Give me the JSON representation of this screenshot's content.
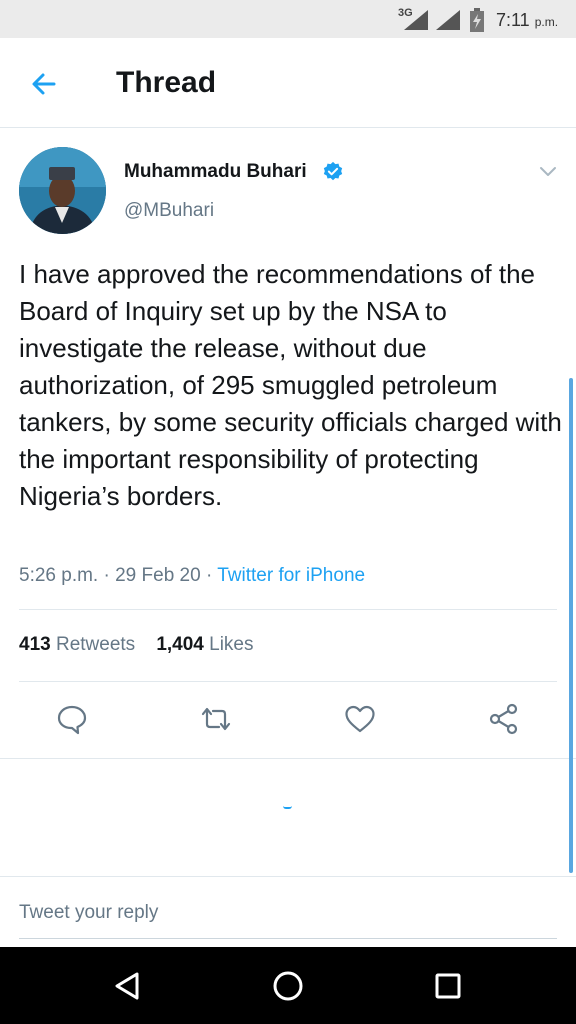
{
  "status_bar": {
    "network": "3G",
    "time": "7:11",
    "time_suffix": "p.m.",
    "icons": [
      "signal-icon",
      "signal-icon",
      "battery-icon"
    ]
  },
  "header": {
    "title": "Thread",
    "back_icon": "arrow-left-icon"
  },
  "tweet": {
    "author_name": "Muhammadu Buhari",
    "handle": "@MBuhari",
    "verified_icon": "verified-badge-icon",
    "text": "I have approved the recommendations of the Board of Inquiry set up by the NSA to investigate the release, without due authorization, of 295 smuggled petroleum tankers, by some security officials charged with the important responsibility of protecting Nigeria’s borders.",
    "time": "5:26 p.m.",
    "separator": "·",
    "date": "29 Feb 20",
    "source": "Twitter for iPhone",
    "retweets_count": "413",
    "retweets_label": "Retweets",
    "likes_count": "1,404",
    "likes_label": "Likes"
  },
  "actions": [
    "reply-icon",
    "retweet-icon",
    "like-icon",
    "share-icon"
  ],
  "reply_box": {
    "placeholder": "Tweet your reply"
  },
  "navigation": [
    "back-triangle-icon",
    "home-circle-icon",
    "recents-square-icon"
  ],
  "colors": {
    "accent": "#1da1f2",
    "text_primary": "#14171a",
    "text_secondary": "#657786",
    "status_bar_bg": "#ebebeb",
    "nav_bar_bg": "#000000"
  }
}
